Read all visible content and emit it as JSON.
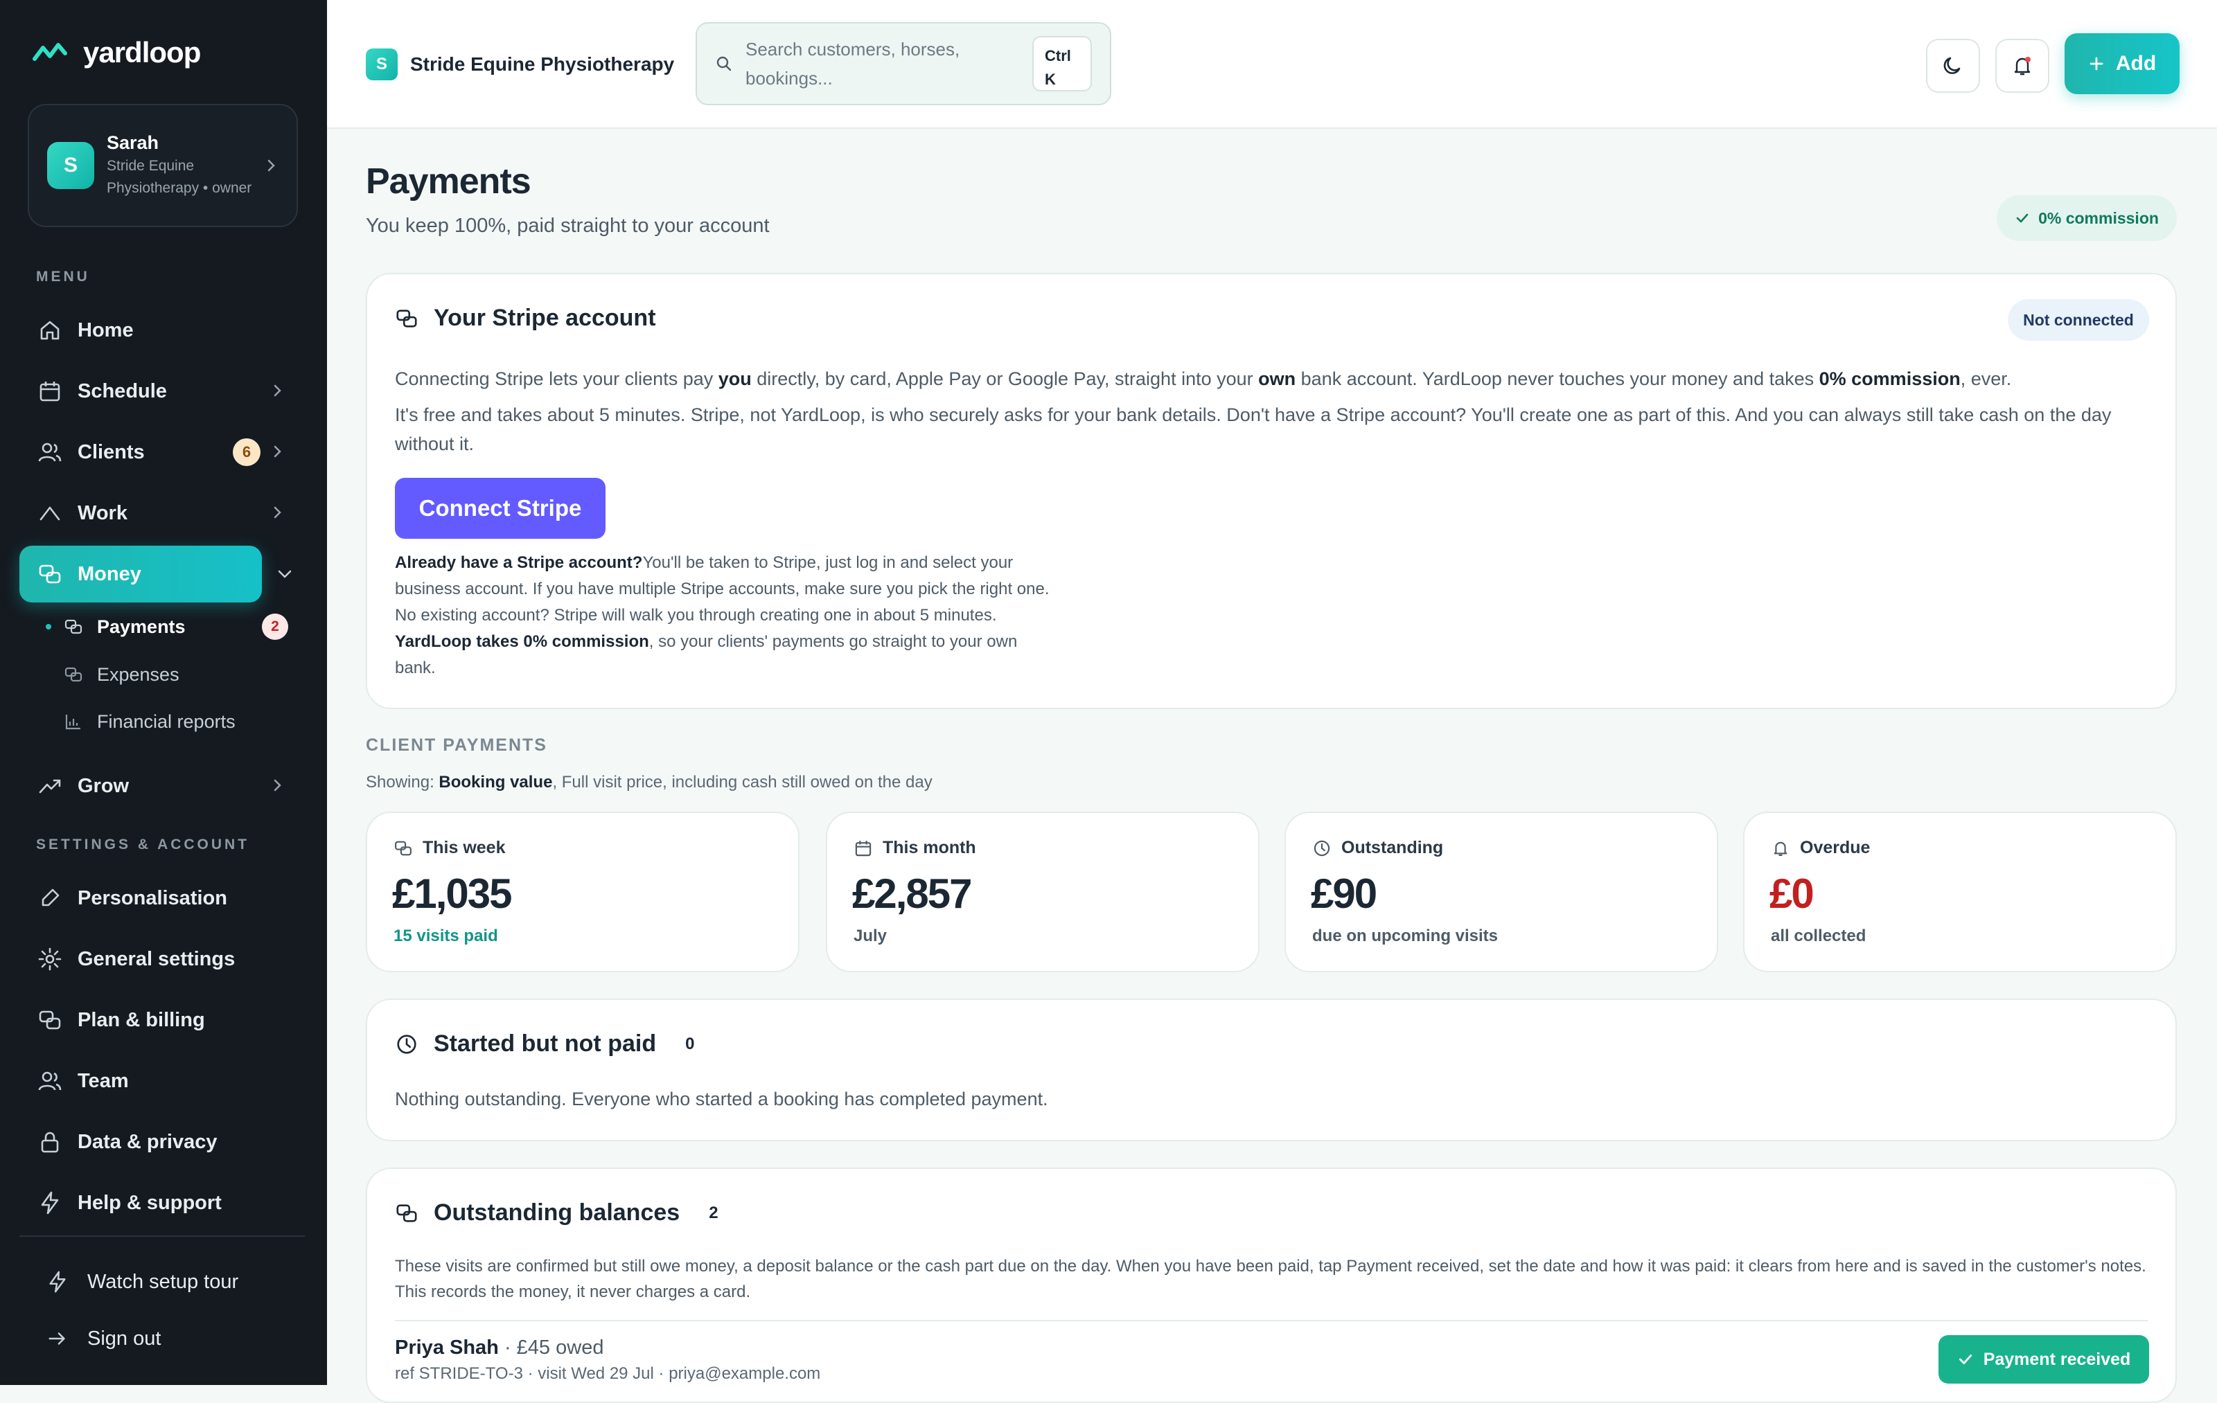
{
  "app": {
    "name": "yardloop"
  },
  "account": {
    "initial": "S",
    "name": "Sarah",
    "subtitle": "Stride Equine Physiotherapy • owner"
  },
  "sidebar": {
    "menu_label": "MENU",
    "items": [
      {
        "label": "Home",
        "icon": "home-icon"
      },
      {
        "label": "Schedule",
        "icon": "calendar-icon"
      },
      {
        "label": "Clients",
        "icon": "users-icon",
        "badge": "6"
      },
      {
        "label": "Work",
        "icon": "work-icon"
      },
      {
        "label": "Money",
        "icon": "coins-icon",
        "active": true
      },
      {
        "label": "Grow",
        "icon": "trending-up-icon"
      }
    ],
    "money_sub": [
      {
        "label": "Payments",
        "badge": "2",
        "active": true
      },
      {
        "label": "Expenses"
      },
      {
        "label": "Financial reports"
      }
    ],
    "settings_label": "SETTINGS & ACCOUNT",
    "settings_items": [
      {
        "label": "Personalisation"
      },
      {
        "label": "General settings"
      },
      {
        "label": "Plan & billing"
      },
      {
        "label": "Team"
      },
      {
        "label": "Data & privacy"
      },
      {
        "label": "Help & support"
      }
    ],
    "footer": [
      {
        "label": "Watch setup tour"
      },
      {
        "label": "Sign out"
      }
    ]
  },
  "topbar": {
    "org_initial": "S",
    "org_name": "Stride Equine Physiotherapy",
    "search_placeholder": "Search customers, horses, bookings...",
    "shortcut_line1": "Ctrl",
    "shortcut_line2": "K",
    "add_label": "Add"
  },
  "page": {
    "title": "Payments",
    "subtitle": "You keep 100%, paid straight to your account",
    "commission_badge": "0% commission"
  },
  "stripe": {
    "title": "Your Stripe account",
    "status": "Not connected",
    "p1_a": "Connecting Stripe lets your clients pay ",
    "p1_b": "you",
    "p1_c": " directly, by card, Apple Pay or Google Pay, straight into your ",
    "p1_d": "own",
    "p1_e": " bank account. YardLoop never touches your money and takes ",
    "p1_f": "0% commission",
    "p1_g": ", ever.",
    "p2": "It's free and takes about 5 minutes. Stripe, not YardLoop, is who securely asks for your bank details. Don't have a Stripe account? You'll create one as part of this. And you can always still take cash on the day without it.",
    "button": "Connect Stripe",
    "note_a": "Already have a Stripe account?",
    "note_b": "You'll be taken to Stripe, just log in and select your business account. If you have multiple Stripe accounts, make sure you pick the right one. No existing account? Stripe will walk you through creating one in about 5 minutes. ",
    "note_c": "YardLoop takes 0% commission",
    "note_d": ", so your clients' payments go straight to your own bank."
  },
  "client_payments": {
    "label": "CLIENT PAYMENTS",
    "showing_a": "Showing: ",
    "showing_b": "Booking value",
    "showing_c": ", Full visit price, including cash still owed on the day",
    "stats": [
      {
        "label": "This week",
        "value": "£1,035",
        "sub": "15 visits paid",
        "icon": "coins-icon"
      },
      {
        "label": "This month",
        "value": "£2,857",
        "sub": "July",
        "icon": "calendar-icon"
      },
      {
        "label": "Outstanding",
        "value": "£90",
        "sub": "due on upcoming visits",
        "icon": "clock-icon"
      },
      {
        "label": "Overdue",
        "value": "£0",
        "sub": "all collected",
        "icon": "bell-icon"
      }
    ]
  },
  "started": {
    "title": "Started but not paid",
    "count": "0",
    "text": "Nothing outstanding. Everyone who started a booking has completed payment."
  },
  "outstanding": {
    "title": "Outstanding balances",
    "count": "2",
    "text": "These visits are confirmed but still owe money, a deposit balance or the cash part due on the day. When you have been paid, tap Payment received, set the date and how it was paid: it clears from here and is saved in the customer's notes. This records the money, it never charges a card.",
    "rows": [
      {
        "name": "Priya Shah",
        "amount": " · £45 owed",
        "meta": "ref STRIDE-TO-3 · visit Wed 29 Jul · priya@example.com",
        "button": "Payment received"
      }
    ]
  },
  "colors": {
    "accent": "#1fb6ad",
    "stripe": "#635bff",
    "overdue": "#c31f1f",
    "sidebar": "#141a20"
  }
}
